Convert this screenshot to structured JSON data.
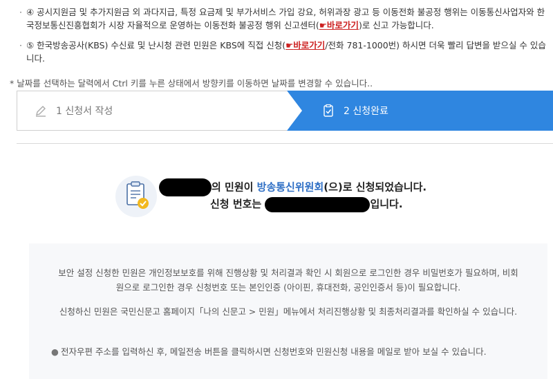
{
  "notices": [
    {
      "bullet": "·",
      "before": "④ 공시지원금 및 추가지원금 외 과다지급, 특정 요금제 및 부가서비스 가입 강요, 허위과장 광고 등 이동전화 불공정 행위는 이동통신사업자와 한국정보통신진흥협회가 시장 자율적으로 운영하는 이동전화 불공정 행위 신고센터(",
      "link": "바로가기",
      "after": ")로 신고 가능합니다."
    },
    {
      "bullet": "·",
      "before": "⑤ 한국방송공사(KBS) 수신료 및 난시청 관련 민원은 KBS에 직접 신청(",
      "link": "바로가기",
      "after": "/전화 781-1000번) 하시면 더욱 빨리 답변을 받으실 수 있습니다."
    }
  ],
  "hint": "* 날짜를 선택하는 달력에서 Ctrl 키를 누른 상태에서 방향키를 이동하면 날짜를 변경할 수 있습니다..",
  "steps": {
    "step1": "1 신청서 작성",
    "step2": "2 신청완료"
  },
  "result": {
    "line1_mid": "의 민원이 ",
    "org": "방송통신위원회",
    "line1_end": "(으)로 신청되었습니다.",
    "line2_start": "신청 번호는 ",
    "line2_end": "입니다."
  },
  "info": {
    "p1": "보안 설정 신청한 민원은 개인정보보호를 위해 진행상황 및 처리결과 확인 시 회원으로 로그인한 경우 비밀번호가 필요하며, 비회원으로 로그인한 경우 신청번호 또는 본인인증 (아이핀, 휴대전화, 공인인증서 등)이 필요합니다.",
    "p2": "신청하신 민원은 국민신문고 홈페이지「나의 신문고 > 민원」메뉴에서 처리진행상황 및 최종처리결과를 확인하실 수 있습니다.",
    "li": "전자우편 주소를 입력하신 후, 메일전송 버튼을 클릭하시면 신청번호와 민원신청 내용을 메일로 받아 보실 수 있습니다."
  },
  "colors": {
    "accent": "#2f86e0",
    "link": "#cc1f1f",
    "org": "#2f6fc5"
  }
}
